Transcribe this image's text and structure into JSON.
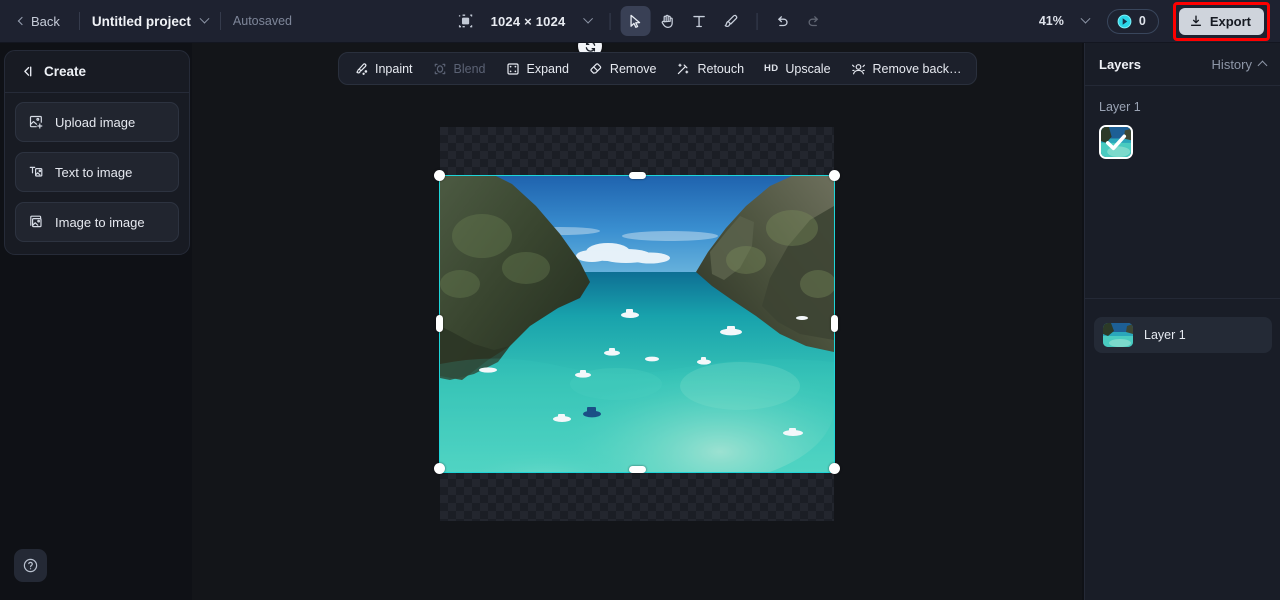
{
  "topbar": {
    "back_label": "Back",
    "project_name": "Untitled project",
    "autosaved_label": "Autosaved",
    "canvas_size": "1024 × 1024",
    "tools": [
      {
        "name": "select-tool",
        "icon": "cursor-icon",
        "active": true
      },
      {
        "name": "pan-tool",
        "icon": "hand-icon",
        "active": false
      },
      {
        "name": "text-tool",
        "icon": "text-icon",
        "active": false
      },
      {
        "name": "brush-tool",
        "icon": "brush-icon",
        "active": false
      },
      {
        "name": "undo",
        "icon": "undo-icon",
        "active": false
      },
      {
        "name": "redo",
        "icon": "redo-icon",
        "active": false
      }
    ],
    "zoom_level": "41%",
    "credits": "0",
    "export_label": "Export",
    "export_highlight_color": "#ff0000"
  },
  "left_panel": {
    "title": "Create",
    "items": [
      {
        "label": "Upload image",
        "icon": "upload-image-icon"
      },
      {
        "label": "Text to image",
        "icon": "text-to-image-icon"
      },
      {
        "label": "Image to image",
        "icon": "image-to-image-icon"
      }
    ]
  },
  "action_bar": {
    "items": [
      {
        "label": "Inpaint",
        "icon": "inpaint-icon",
        "disabled": false
      },
      {
        "label": "Blend",
        "icon": "blend-icon",
        "disabled": true
      },
      {
        "label": "Expand",
        "icon": "expand-icon",
        "disabled": false
      },
      {
        "label": "Remove",
        "icon": "eraser-icon",
        "disabled": false
      },
      {
        "label": "Retouch",
        "icon": "retouch-icon",
        "disabled": false
      },
      {
        "label": "Upscale",
        "icon": "hd-icon",
        "disabled": false
      },
      {
        "label": "Remove back…",
        "icon": "remove-background-icon",
        "disabled": false
      }
    ]
  },
  "right_panel": {
    "tab_layers": "Layers",
    "tab_history": "History",
    "section_title": "Layer 1",
    "layer_row_label": "Layer 1"
  },
  "canvas": {
    "selection_color": "#1fd5d8",
    "background_color": "#131519",
    "image_description": "Maya Bay tropical lagoon with limestone cliffs and boats"
  },
  "help": {
    "icon": "question-mark-icon"
  }
}
